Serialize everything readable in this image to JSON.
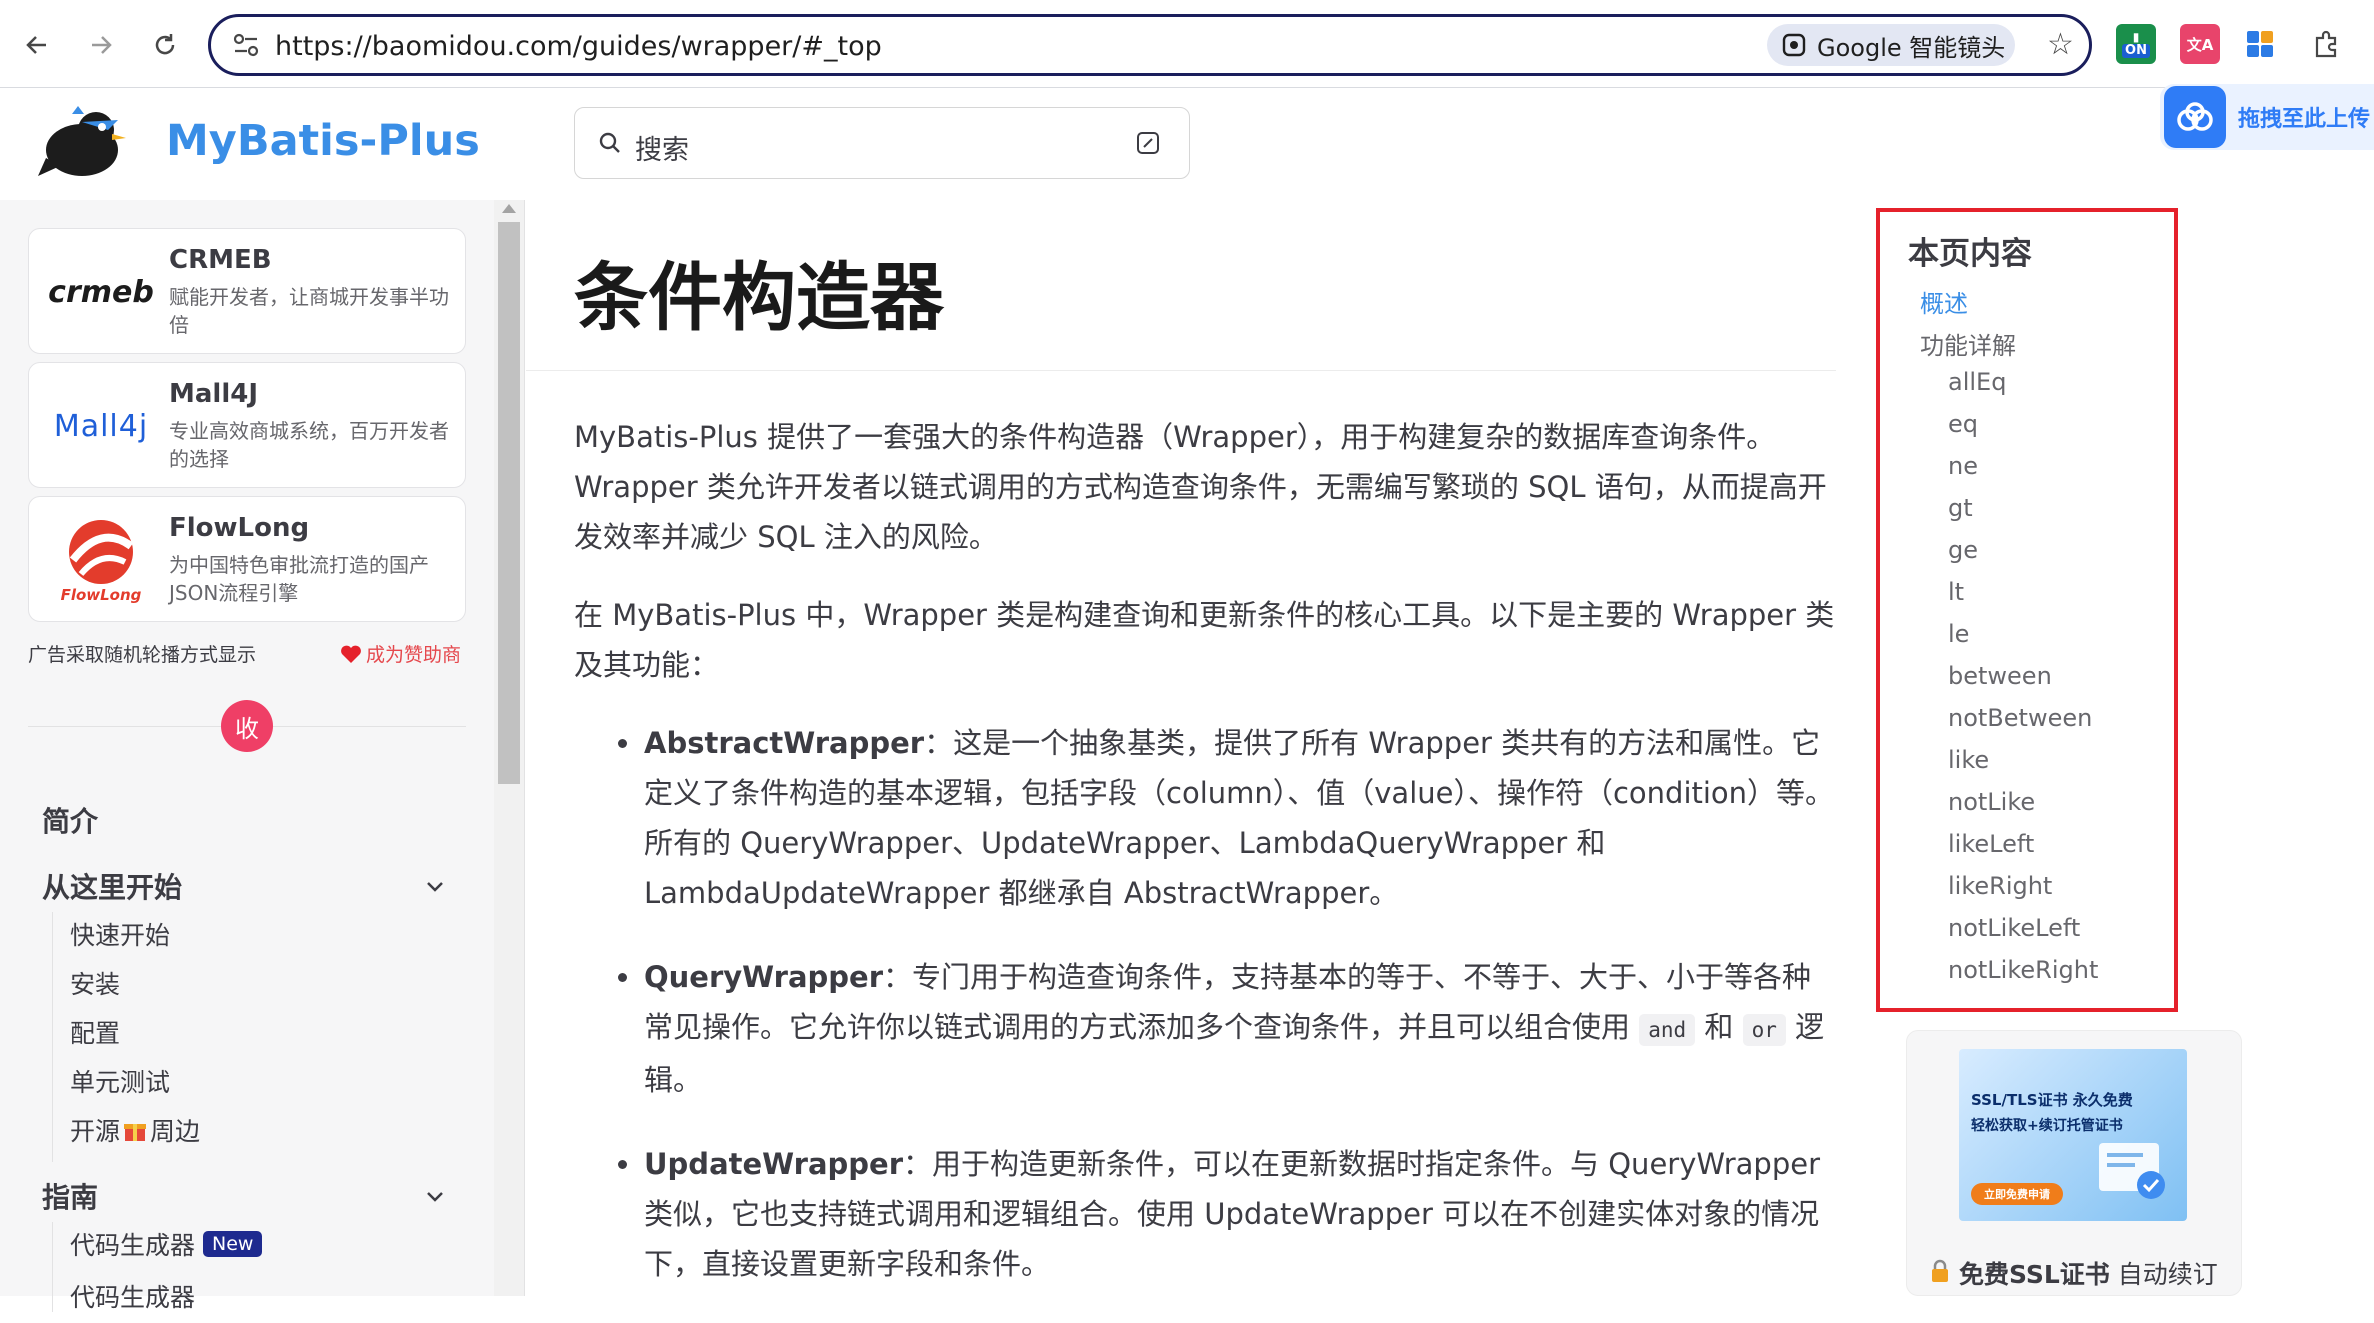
{
  "browser": {
    "url": "https://baomidou.com/guides/wrapper/#_top",
    "lens_label": "Google 智能镜头",
    "ext_on_label": "ON"
  },
  "site": {
    "title": "MyBatis-Plus",
    "search_placeholder": "搜索",
    "upload_label": "拖拽至此上传"
  },
  "sidebar": {
    "ads": [
      {
        "name": "CRMEB",
        "desc": "赋能开发者，让商城开发事半功倍",
        "logo": "crmeb"
      },
      {
        "name": "Mall4J",
        "desc": "专业高效商城系统，百万开发者的选择",
        "logo": "Mall4j"
      },
      {
        "name": "FlowLong",
        "desc": "为中国特色审批流打造的国产JSON流程引擎",
        "logo": "FlowLong"
      }
    ],
    "ad_note": "广告采取随机轮播方式显示",
    "sponsor_label": "成为赞助商",
    "collapse_label": "收",
    "sections": [
      {
        "title": "简介"
      },
      {
        "title": "从这里开始",
        "items": [
          "快速开始",
          "安装",
          "配置",
          "单元测试",
          "开源",
          "周边"
        ]
      },
      {
        "title": "指南",
        "items": [
          "代码生成器",
          "代码生成器"
        ]
      }
    ],
    "new_badge": "New"
  },
  "article": {
    "title": "条件构造器",
    "p1": "MyBatis-Plus 提供了一套强大的条件构造器（Wrapper），用于构建复杂的数据库查询条件。Wrapper 类允许开发者以链式调用的方式构造查询条件，无需编写繁琐的 SQL 语句，从而提高开发效率并减少 SQL 注入的风险。",
    "p2": "在 MyBatis-Plus 中，Wrapper 类是构建查询和更新条件的核心工具。以下是主要的 Wrapper 类及其功能：",
    "items": [
      {
        "term": "AbstractWrapper",
        "text": "：这是一个抽象基类，提供了所有 Wrapper 类共有的方法和属性。它定义了条件构造的基本逻辑，包括字段（column）、值（value）、操作符（condition）等。所有的 QueryWrapper、UpdateWrapper、LambdaQueryWrapper 和 LambdaUpdateWrapper 都继承自 AbstractWrapper。"
      },
      {
        "term": "QueryWrapper",
        "text_a": "：专门用于构造查询条件，支持基本的等于、不等于、大于、小于等各种常见操作。它允许你以链式调用的方式添加多个查询条件，并且可以组合使用 ",
        "code1": "and",
        "text_b": " 和 ",
        "code2": "or",
        "text_c": " 逻辑。"
      },
      {
        "term": "UpdateWrapper",
        "text": "：用于构造更新条件，可以在更新数据时指定条件。与 QueryWrapper 类似，它也支持链式调用和逻辑组合。使用 UpdateWrapper 可以在不创建实体对象的情况下，直接设置更新字段和条件。"
      }
    ]
  },
  "toc": {
    "title": "本页内容",
    "items": [
      "概述",
      "功能详解",
      "allEq",
      "eq",
      "ne",
      "gt",
      "ge",
      "lt",
      "le",
      "between",
      "notBetween",
      "like",
      "notLike",
      "likeLeft",
      "likeRight",
      "notLikeLeft",
      "notLikeRight"
    ],
    "active_index": 0
  },
  "right_ad": {
    "image_title": "SSL/TLS证书 永久免费",
    "image_subtitle": "轻松获取+续订托管证书",
    "image_button": "立即免费申请",
    "caption_bold": "免费SSL证书",
    "caption_rest": " 自动续订"
  },
  "colors": {
    "accent": "#3a8ee6",
    "highlight_box": "#e5212b",
    "collapse_button": "#ef3f66",
    "badge": "#1e2a8f"
  }
}
